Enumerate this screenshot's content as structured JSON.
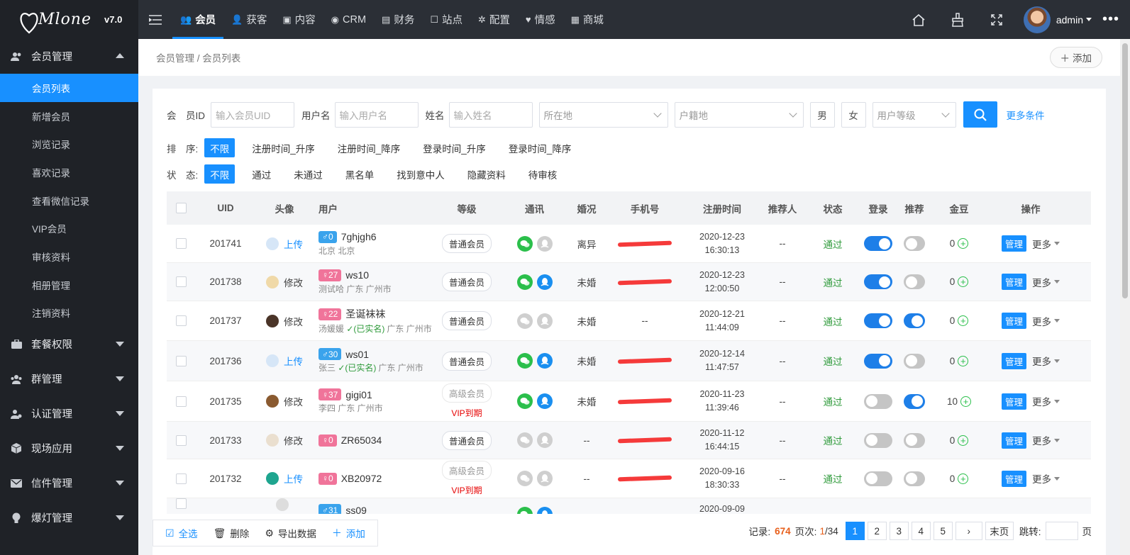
{
  "app": {
    "brand": "Mlone",
    "version": "v7.0"
  },
  "topnav": {
    "tabs": [
      {
        "label": "会员",
        "icon": "users-icon"
      },
      {
        "label": "获客",
        "icon": "user-icon"
      },
      {
        "label": "内容",
        "icon": "doc-icon"
      },
      {
        "label": "CRM",
        "icon": "crm-icon"
      },
      {
        "label": "财务",
        "icon": "finance-icon"
      },
      {
        "label": "站点",
        "icon": "site-icon"
      },
      {
        "label": "配置",
        "icon": "gear-icon"
      },
      {
        "label": "情感",
        "icon": "heart-icon"
      },
      {
        "label": "商城",
        "icon": "shop-icon"
      }
    ],
    "user": "admin",
    "more": "•••"
  },
  "sidebar": {
    "open_group": "会员管理",
    "sub_items": [
      "会员列表",
      "新增会员",
      "浏览记录",
      "喜欢记录",
      "查看微信记录",
      "VIP会员",
      "审核资料",
      "相册管理",
      "注销资料"
    ],
    "groups": [
      "套餐权限",
      "群管理",
      "认证管理",
      "现场应用",
      "信件管理",
      "爆灯管理"
    ]
  },
  "breadcrumb": "会员管理 / 会员列表",
  "add_button": "添加",
  "filters": {
    "uid_label": "会　员ID",
    "uid_placeholder": "输入会员UID",
    "username_label": "用户名",
    "username_placeholder": "输入用户名",
    "name_label": "姓名",
    "name_placeholder": "输入姓名",
    "location": "所在地",
    "hukou": "户籍地",
    "male": "男",
    "female": "女",
    "level": "用户等级",
    "more": "更多条件",
    "sort_label": "排　序:",
    "sort_options": [
      "不限",
      "注册时间_升序",
      "注册时间_降序",
      "登录时间_升序",
      "登录时间_降序"
    ],
    "status_label": "状　态:",
    "status_options": [
      "不限",
      "通过",
      "未通过",
      "黑名单",
      "找到意中人",
      "隐藏资料",
      "待审核"
    ]
  },
  "table": {
    "headers": [
      "UID",
      "头像",
      "用户",
      "等级",
      "通讯",
      "婚况",
      "手机号",
      "注册时间",
      "推荐人",
      "状态",
      "登录",
      "推荐",
      "金豆",
      "操作"
    ],
    "rows": [
      {
        "uid": "201741",
        "avatar_action": "上传",
        "gender": "♂",
        "age": "0",
        "name": "7ghjgh6",
        "location": "北京 北京",
        "level": "普通会员",
        "marital": "离异",
        "date": "2020-12-23",
        "time": "16:30:13",
        "referrer": "--",
        "status": "通过",
        "beans": "0"
      },
      {
        "uid": "201738",
        "avatar_action": "修改",
        "gender": "♀",
        "age": "27",
        "name": "ws10",
        "location": "测试哈 广东 广州市",
        "level": "普通会员",
        "marital": "未婚",
        "date": "2020-12-23",
        "time": "12:00:50",
        "referrer": "--",
        "status": "通过",
        "beans": "0"
      },
      {
        "uid": "201737",
        "avatar_action": "修改",
        "gender": "♀",
        "age": "22",
        "name": "圣诞袜袜",
        "location_pre": "汤媛媛",
        "verified": "(已实名)",
        "location": "广东 广州市",
        "level": "普通会员",
        "marital": "未婚",
        "phone": "--",
        "date": "2020-12-21",
        "time": "11:44:09",
        "referrer": "--",
        "status": "通过",
        "beans": "0"
      },
      {
        "uid": "201736",
        "avatar_action": "上传",
        "gender": "♂",
        "age": "30",
        "name": "ws01",
        "location_pre": "张三",
        "verified": "(已实名)",
        "location": "广东 广州市",
        "level": "普通会员",
        "marital": "未婚",
        "date": "2020-12-14",
        "time": "11:47:57",
        "referrer": "--",
        "status": "通过",
        "beans": "0"
      },
      {
        "uid": "201735",
        "avatar_action": "修改",
        "gender": "♀",
        "age": "37",
        "name": "gigi01",
        "location": "李四 广东 广州市",
        "level": "高级会员",
        "vip": "VIP到期",
        "marital": "未婚",
        "date": "2020-11-23",
        "time": "11:39:46",
        "referrer": "--",
        "status": "通过",
        "beans": "10"
      },
      {
        "uid": "201733",
        "avatar_action": "修改",
        "gender": "♀",
        "age": "0",
        "name": "ZR65034",
        "location": "",
        "level": "普通会员",
        "marital": "--",
        "date": "2020-11-12",
        "time": "16:44:15",
        "referrer": "--",
        "status": "通过",
        "beans": "0"
      },
      {
        "uid": "201732",
        "avatar_action": "上传",
        "gender": "♀",
        "age": "0",
        "name": "XB20972",
        "location": "",
        "level": "高级会员",
        "vip": "VIP到期",
        "marital": "--",
        "date": "2020-09-16",
        "time": "18:30:33",
        "referrer": "--",
        "status": "通过",
        "beans": "0"
      },
      {
        "uid": "",
        "avatar_action": "",
        "gender": "♂",
        "age": "31",
        "name": "ss09",
        "location": "",
        "level": "",
        "marital": "",
        "date": "2020-09-09",
        "time": "",
        "referrer": "",
        "status": "",
        "beans": ""
      }
    ],
    "manage_label": "管理",
    "more_label": "更多"
  },
  "footer": {
    "select_all": "全选",
    "delete": "删除",
    "export": "导出数据",
    "add": "添加",
    "records_label": "记录:",
    "records": "674",
    "page_label": "页次:",
    "page_current": "1",
    "page_total": "/34",
    "pages": [
      "1",
      "2",
      "3",
      "4",
      "5"
    ],
    "next": "›",
    "last": "末页",
    "jump_label": "跳转:",
    "page_unit": "页"
  }
}
